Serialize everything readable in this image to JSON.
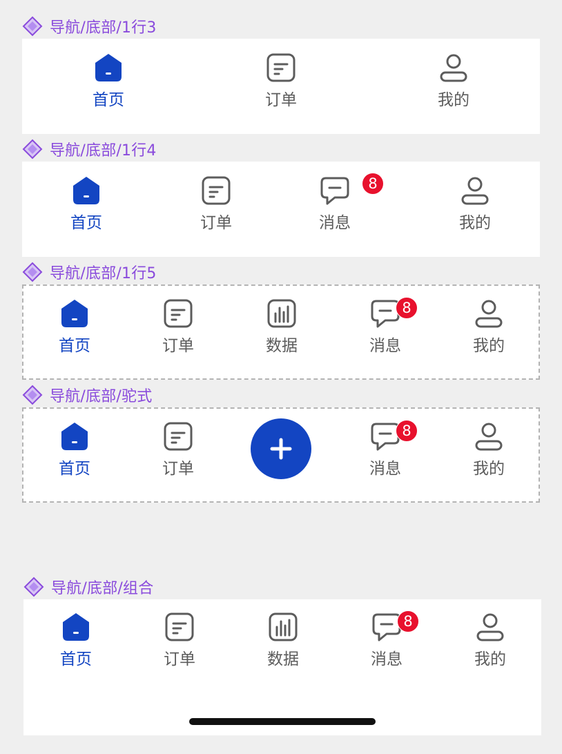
{
  "sections": [
    {
      "title": "导航/底部/1行3",
      "tabs": [
        {
          "label": "首页"
        },
        {
          "label": "订单"
        },
        {
          "label": "我的"
        }
      ]
    },
    {
      "title": "导航/底部/1行4",
      "tabs": [
        {
          "label": "首页"
        },
        {
          "label": "订单"
        },
        {
          "label": "消息",
          "badge": "8"
        },
        {
          "label": "我的"
        }
      ]
    },
    {
      "title": "导航/底部/1行5",
      "tabs": [
        {
          "label": "首页"
        },
        {
          "label": "订单"
        },
        {
          "label": "数据"
        },
        {
          "label": "消息",
          "badge": "8"
        },
        {
          "label": "我的"
        }
      ]
    },
    {
      "title": "导航/底部/驼式",
      "tabs": [
        {
          "label": "首页"
        },
        {
          "label": "订单"
        },
        {
          "label": "消息",
          "badge": "8"
        },
        {
          "label": "我的"
        }
      ]
    },
    {
      "title": "导航/底部/组合",
      "tabs": [
        {
          "label": "首页"
        },
        {
          "label": "订单"
        },
        {
          "label": "数据"
        },
        {
          "label": "消息",
          "badge": "8"
        },
        {
          "label": "我的"
        }
      ]
    }
  ],
  "colors": {
    "primary": "#1345c2",
    "icon_gray": "#5c5c5c",
    "badge_red": "#e8112d",
    "title_purple": "#8a4bdc",
    "page_bg": "#efefef"
  },
  "icons": {
    "home": "home-icon",
    "orders": "order-icon",
    "data": "chart-icon",
    "messages": "message-icon",
    "profile": "user-icon",
    "add": "plus-icon",
    "component": "diamond-icon"
  }
}
